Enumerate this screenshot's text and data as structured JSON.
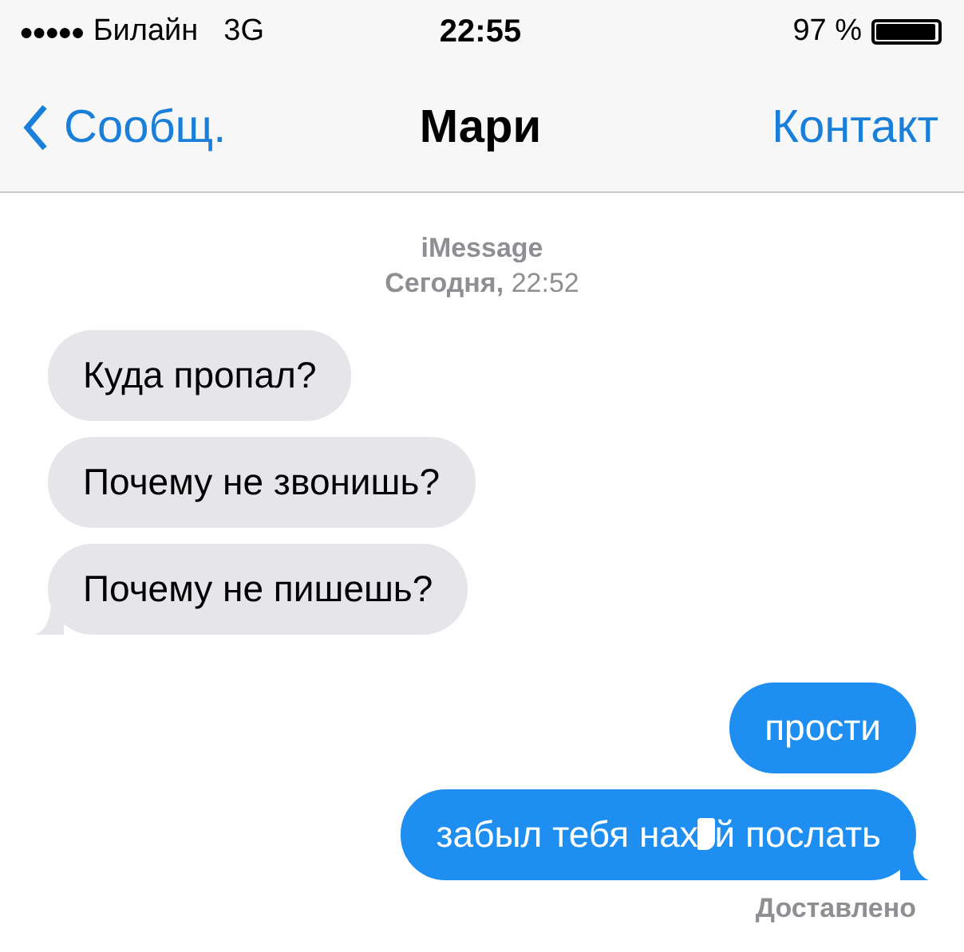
{
  "status_bar": {
    "signal_dots": "●●●●●",
    "carrier": "Билайн",
    "network": "3G",
    "time": "22:55",
    "battery_text": "97 %",
    "battery": {
      "level": 0.97
    }
  },
  "nav": {
    "back": "Сообщ.",
    "title": "Мари",
    "action": "Контакт"
  },
  "header": {
    "service": "iMessage",
    "day": "Сегодня,",
    "time": "22:52"
  },
  "messages": [
    {
      "kind": "incoming",
      "parts": [
        "Куда пропал?"
      ],
      "tail": false
    },
    {
      "kind": "incoming",
      "parts": [
        "Почему не звонишь?"
      ],
      "tail": false
    },
    {
      "kind": "incoming",
      "parts": [
        "Почему не пишешь?"
      ],
      "tail": true
    },
    {
      "kind": "outgoing",
      "parts": [
        "прости"
      ],
      "tail": false
    },
    {
      "kind": "outgoing",
      "parts": [
        "забыл тебя нах",
        "й послать"
      ],
      "tail": true
    }
  ],
  "delivery": "Доставлено"
}
